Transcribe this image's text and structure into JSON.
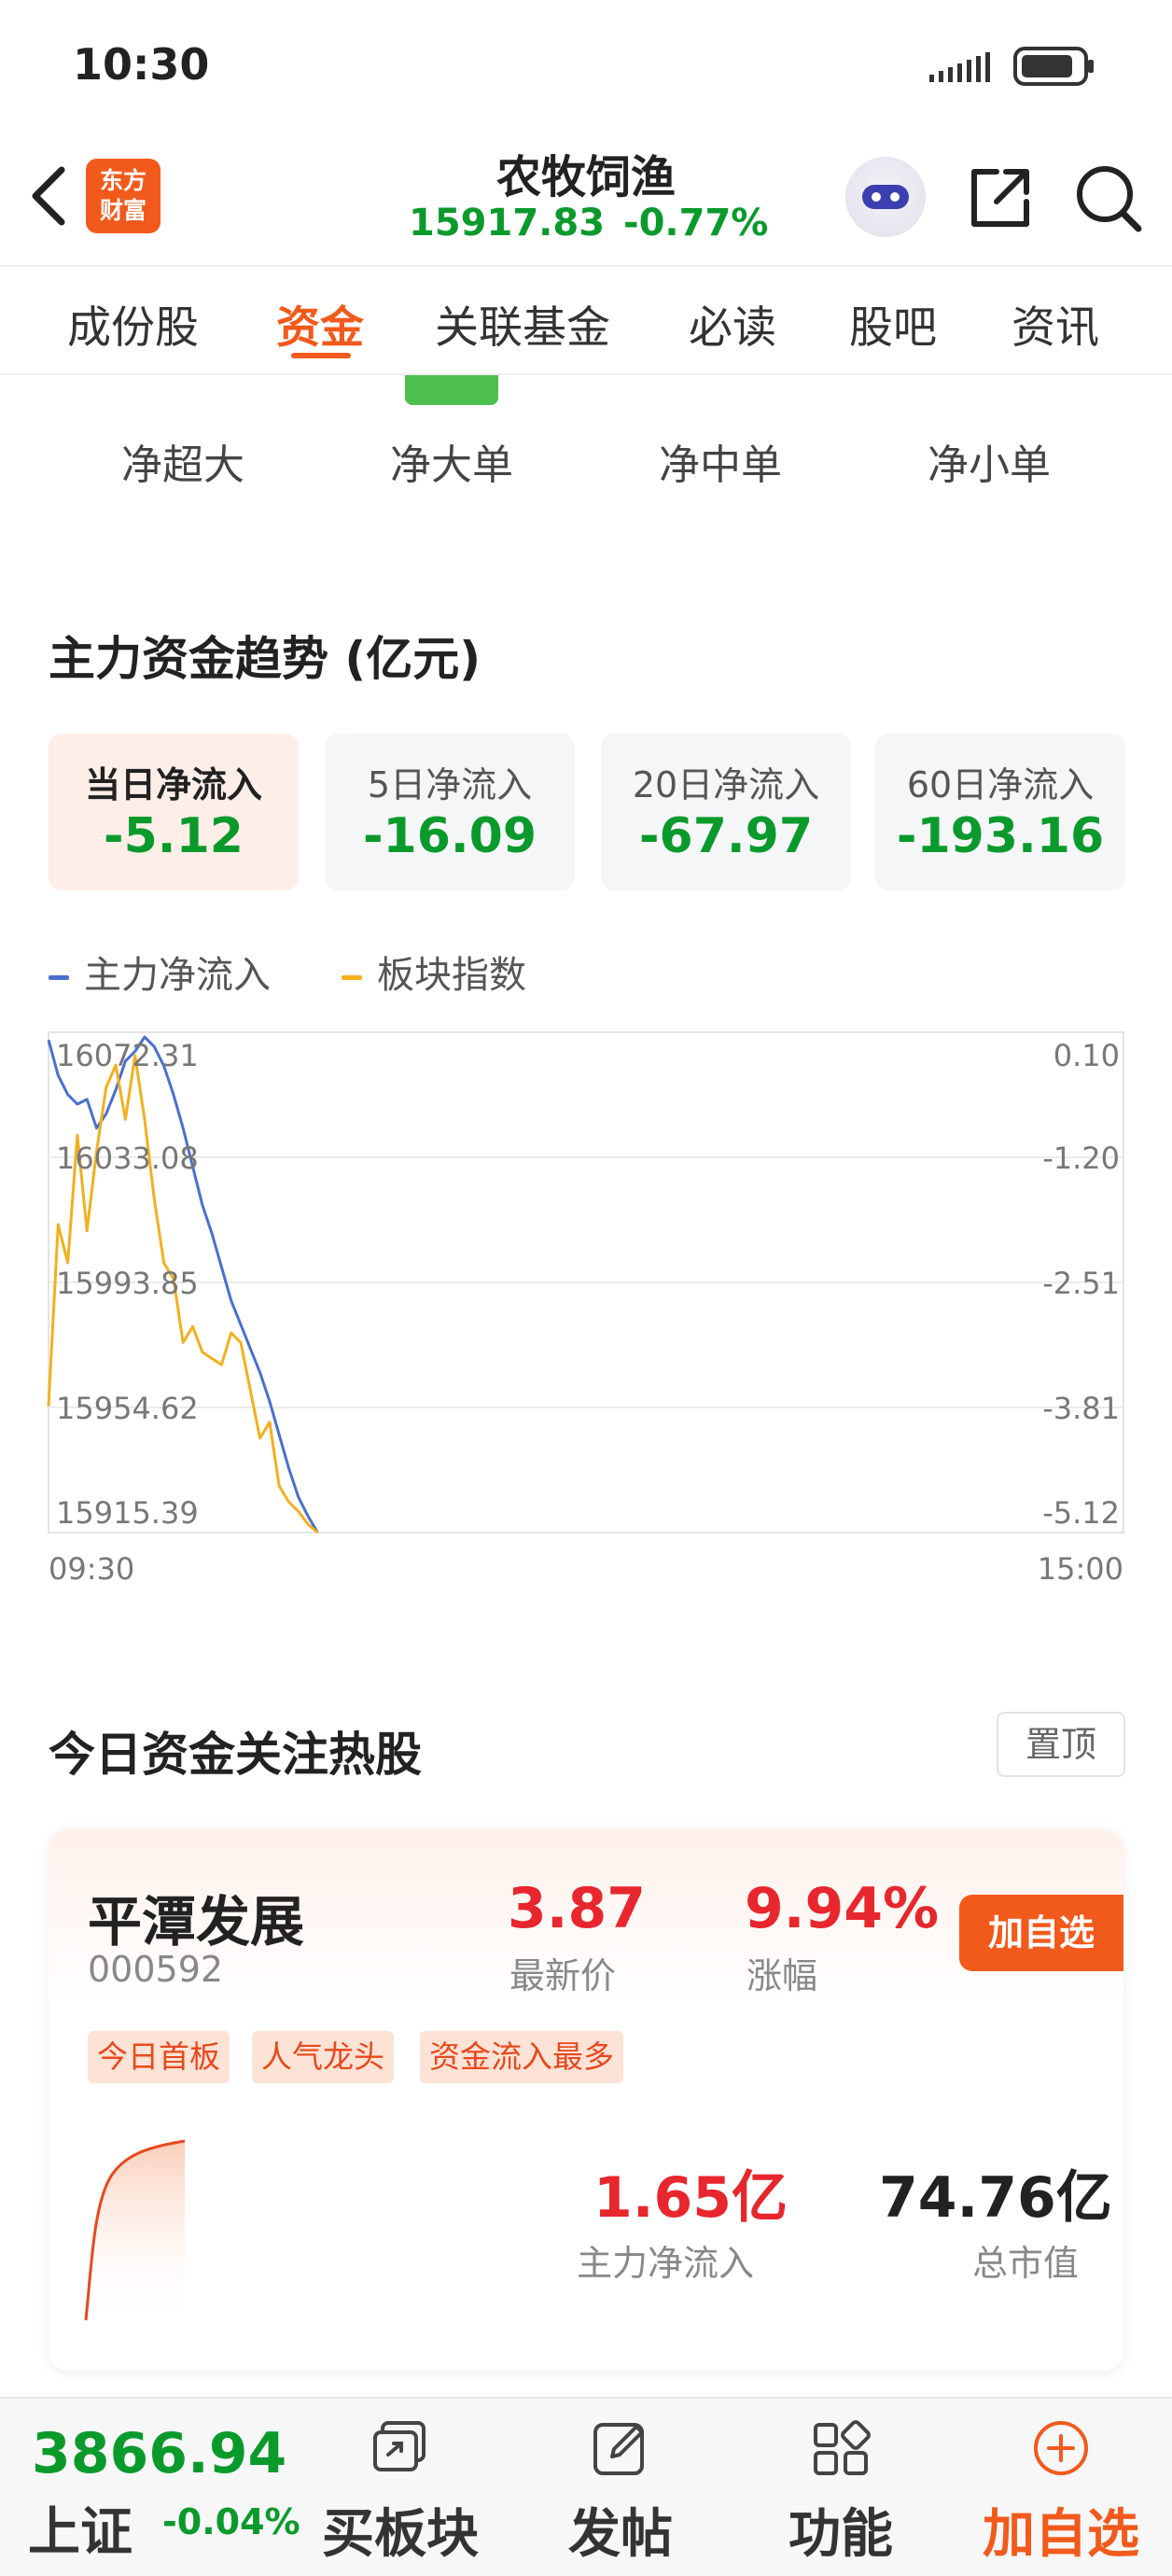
{
  "status_bar": {
    "time": "10:30"
  },
  "header": {
    "logo_text": "东方财富",
    "title": "农牧饲渔",
    "index_value": "15917.83",
    "index_change": "-0.77%"
  },
  "tabs": [
    {
      "label": "成份股",
      "active": false
    },
    {
      "label": "资金",
      "active": true
    },
    {
      "label": "关联基金",
      "active": false
    },
    {
      "label": "必读",
      "active": false
    },
    {
      "label": "股吧",
      "active": false
    },
    {
      "label": "资讯",
      "active": false
    }
  ],
  "subtabs": [
    "净超大",
    "净大单",
    "净中单",
    "净小单"
  ],
  "section_title": "主力资金趋势 (亿元)",
  "flow_cards": [
    {
      "label": "当日净流入",
      "value": "-5.12",
      "selected": true
    },
    {
      "label": "5日净流入",
      "value": "-16.09",
      "selected": false
    },
    {
      "label": "20日净流入",
      "value": "-67.97",
      "selected": false
    },
    {
      "label": "60日净流入",
      "value": "-193.16",
      "selected": false
    }
  ],
  "legend": {
    "main": "主力净流入",
    "index": "板块指数"
  },
  "colors": {
    "accent": "#f25a1c",
    "down_green": "#0a9a2c",
    "up_red": "#e8262d",
    "main_flow_line": "#4a6fd0",
    "index_line": "#f2b01e"
  },
  "chart_data": {
    "type": "line",
    "x_start": "09:30",
    "x_end": "15:00",
    "y_left_ticks": [
      "16072.31",
      "16033.08",
      "15993.85",
      "15954.62",
      "15915.39"
    ],
    "y_right_ticks": [
      "0.10",
      "-1.20",
      "-2.51",
      "-3.81",
      "-5.12"
    ],
    "y_left_range": [
      15915.39,
      16072.31
    ],
    "y_right_range": [
      -5.12,
      0.1
    ],
    "grid": true,
    "series": [
      {
        "name": "主力净流入",
        "axis": "right",
        "values": [
          0.02,
          -0.35,
          -0.55,
          -0.65,
          -0.6,
          -0.9,
          -0.75,
          -0.5,
          -0.2,
          -0.1,
          0.05,
          -0.05,
          -0.25,
          -0.55,
          -0.9,
          -1.3,
          -1.7,
          -2.0,
          -2.35,
          -2.7,
          -2.95,
          -3.2,
          -3.45,
          -3.75,
          -4.1,
          -4.45,
          -4.75,
          -4.95,
          -5.12
        ]
      },
      {
        "name": "板块指数",
        "axis": "left",
        "values": [
          15955,
          16012,
          16000,
          16040,
          16010,
          16035,
          16055,
          16062,
          16045,
          16065,
          16045,
          16020,
          16000,
          15995,
          15975,
          15980,
          15972,
          15970,
          15968,
          15978,
          15975,
          15960,
          15945,
          15950,
          15930,
          15925,
          15922,
          15918,
          15915.4
        ]
      }
    ]
  },
  "hot_section": {
    "title": "今日资金关注热股",
    "pin_label": "置顶"
  },
  "stock_card": {
    "name": "平潭发展",
    "code": "000592",
    "price": "3.87",
    "price_label": "最新价",
    "change": "9.94%",
    "change_label": "涨幅",
    "add_label": "加自选",
    "tags": [
      "今日首板",
      "人气龙头",
      "资金流入最多"
    ],
    "main_inflow": "1.65亿",
    "main_inflow_label": "主力净流入",
    "market_cap": "74.76亿",
    "market_cap_label": "总市值"
  },
  "bottom_bar": {
    "index_value": "3866.94",
    "index_name": "上证",
    "index_change": "-0.04%",
    "nav": [
      {
        "label": "买板块",
        "icon": "buy-sector-icon"
      },
      {
        "label": "发帖",
        "icon": "post-edit-icon"
      },
      {
        "label": "功能",
        "icon": "functions-grid-icon"
      },
      {
        "label": "加自选",
        "icon": "add-watchlist-icon"
      }
    ]
  }
}
